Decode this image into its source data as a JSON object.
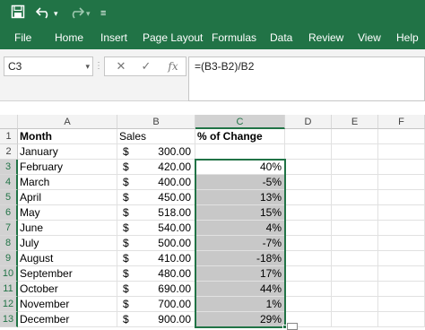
{
  "toolbar": {
    "save_icon": "save-icon",
    "undo_icon": "undo-icon",
    "redo_icon": "redo-icon",
    "customize_icon": "customize-qat-icon"
  },
  "menu": [
    "File",
    "Home",
    "Insert",
    "Page Layout",
    "Formulas",
    "Data",
    "Review",
    "View",
    "Help"
  ],
  "formula_bar": {
    "name_box": "C3",
    "cancel": "✕",
    "enter": "✓",
    "fx": "fx",
    "formula": "=(B3-B2)/B2"
  },
  "columns": [
    "A",
    "B",
    "C",
    "D",
    "E",
    "F"
  ],
  "rows": [
    "1",
    "2",
    "3",
    "4",
    "5",
    "6",
    "7",
    "8",
    "9",
    "10",
    "11",
    "12",
    "13"
  ],
  "cells": {
    "header": {
      "month": "Month",
      "sales": "Sales",
      "change": "% of Change"
    },
    "data": [
      {
        "month": "January",
        "cur": "$",
        "sales": "300.00",
        "change": ""
      },
      {
        "month": "February",
        "cur": "$",
        "sales": "420.00",
        "change": "40%"
      },
      {
        "month": "March",
        "cur": "$",
        "sales": "400.00",
        "change": "-5%"
      },
      {
        "month": "April",
        "cur": "$",
        "sales": "450.00",
        "change": "13%"
      },
      {
        "month": "May",
        "cur": "$",
        "sales": "518.00",
        "change": "15%"
      },
      {
        "month": "June",
        "cur": "$",
        "sales": "540.00",
        "change": "4%"
      },
      {
        "month": "July",
        "cur": "$",
        "sales": "500.00",
        "change": "-7%"
      },
      {
        "month": "August",
        "cur": "$",
        "sales": "410.00",
        "change": "-18%"
      },
      {
        "month": "September",
        "cur": "$",
        "sales": "480.00",
        "change": "17%"
      },
      {
        "month": "October",
        "cur": "$",
        "sales": "690.00",
        "change": "44%"
      },
      {
        "month": "November",
        "cur": "$",
        "sales": "700.00",
        "change": "1%"
      },
      {
        "month": "December",
        "cur": "$",
        "sales": "900.00",
        "change": "29%"
      }
    ]
  },
  "colors": {
    "accent": "#217346",
    "selection_fill": "#c8c8c8"
  }
}
